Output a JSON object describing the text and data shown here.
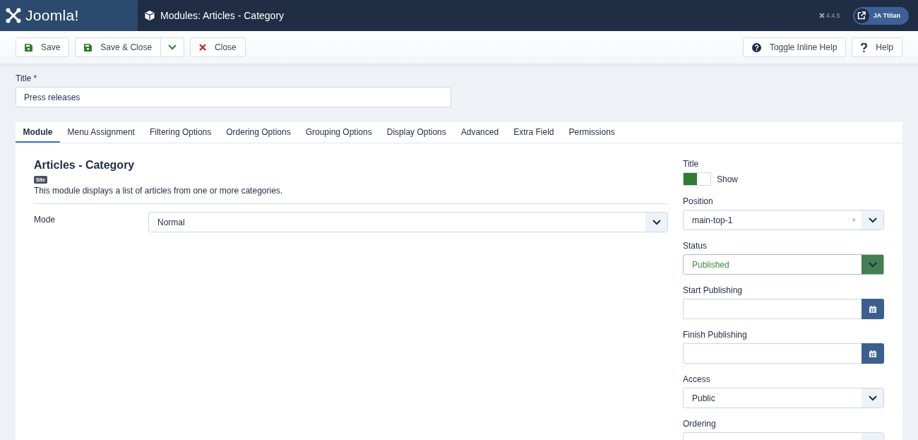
{
  "header": {
    "logo_text": "Joomla!",
    "page_title": "Modules: Articles - Category",
    "version": "4.4.5",
    "user_button": "JA Ttitan"
  },
  "toolbar": {
    "left": [
      {
        "kind": "save",
        "label": "Save",
        "dropdown": false
      },
      {
        "kind": "save_close",
        "label": "Save & Close",
        "dropdown": true
      },
      {
        "kind": "close",
        "label": "Close",
        "dropdown": false
      }
    ],
    "right": [
      {
        "kind": "toggle_help",
        "label": "Toggle Inline Help"
      },
      {
        "kind": "help",
        "label": "Help"
      }
    ]
  },
  "title_field": {
    "label": "Title *",
    "value": "Press releases"
  },
  "tabs": [
    {
      "label": "Module",
      "selected": true
    },
    {
      "label": "Menu Assignment",
      "selected": false
    },
    {
      "label": "Filtering Options",
      "selected": false
    },
    {
      "label": "Ordering Options",
      "selected": false
    },
    {
      "label": "Grouping Options",
      "selected": false
    },
    {
      "label": "Display Options",
      "selected": false
    },
    {
      "label": "Advanced",
      "selected": false
    },
    {
      "label": "Extra Field",
      "selected": false
    },
    {
      "label": "Permissions",
      "selected": false
    }
  ],
  "module": {
    "heading": "Articles - Category",
    "badge": "Site",
    "description": "This module displays a list of articles from one or more categories.",
    "fields": [
      {
        "label": "Mode",
        "value": "Normal"
      }
    ]
  },
  "sidebar": {
    "fields": [
      {
        "kind": "toggle",
        "label": "Title",
        "on": true,
        "text": "Show"
      },
      {
        "kind": "select",
        "label": "Position",
        "value": "main-top-1",
        "clear": "×"
      },
      {
        "kind": "status",
        "label": "Status",
        "value": "Published"
      },
      {
        "kind": "date",
        "label": "Start Publishing"
      },
      {
        "kind": "date",
        "label": "Finish Publishing"
      },
      {
        "kind": "select",
        "label": "Access",
        "value": "Public"
      },
      {
        "kind": "select",
        "label": "Ordering"
      }
    ]
  }
}
